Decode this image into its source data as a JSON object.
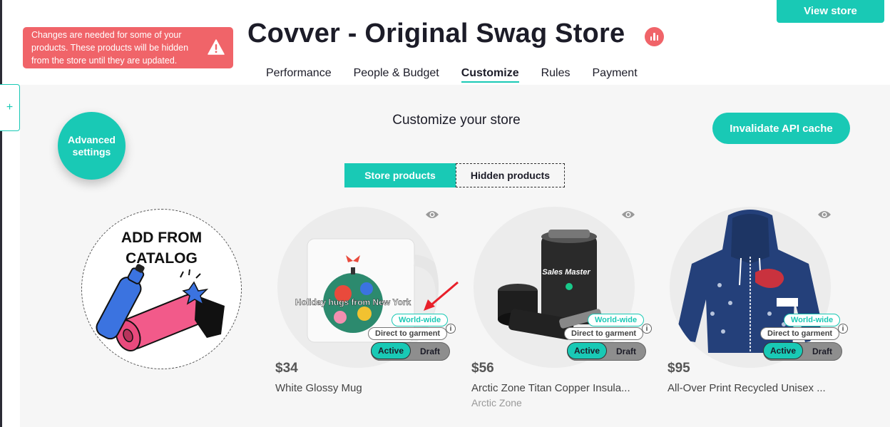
{
  "header": {
    "view_store_label": "View store",
    "store_title": "Covver - Original Swag Store",
    "alert_text": "Changes are needed for some of your products. These products will be hidden from the store until they are updated."
  },
  "tabs": [
    {
      "label": "Performance"
    },
    {
      "label": "People & Budget"
    },
    {
      "label": "Customize"
    },
    {
      "label": "Rules"
    },
    {
      "label": "Payment"
    }
  ],
  "active_tab": "Customize",
  "side_tab": {
    "label": "+"
  },
  "customize": {
    "section_title": "Customize your store",
    "advanced_settings_label": "Advanced settings",
    "invalidate_label": "Invalidate API cache",
    "toggle": {
      "store_products": "Store products",
      "hidden_products": "Hidden products",
      "selected": "Store products"
    },
    "catalog_label": "ADD FROM CATALOG"
  },
  "products": [
    {
      "price": "$34",
      "name": "White Glossy Mug",
      "brand": "",
      "ww_label": "World-wide",
      "dg_label": "Direct to garment",
      "active_label": "Active",
      "draft_label": "Draft",
      "mug_text": "Holiday hugs from New York"
    },
    {
      "price": "$56",
      "name": "Arctic Zone Titan Copper Insula...",
      "brand": "Arctic Zone",
      "ww_label": "World-wide",
      "dg_label": "Direct to garment",
      "active_label": "Active",
      "draft_label": "Draft",
      "can_text": "Sales Master"
    },
    {
      "price": "$95",
      "name": "All-Over Print Recycled Unisex ...",
      "brand": "",
      "ww_label": "World-wide",
      "dg_label": "Direct to garment",
      "active_label": "Active",
      "draft_label": "Draft"
    }
  ],
  "colors": {
    "accent": "#19c9b5",
    "alert": "#f06469",
    "text": "#1c1c28",
    "panel": "#f6f6f6"
  },
  "icons": {
    "alert": "warning-triangle-icon",
    "badge": "bar-chart-icon",
    "visibility": "eye-icon",
    "info": "info-icon"
  }
}
